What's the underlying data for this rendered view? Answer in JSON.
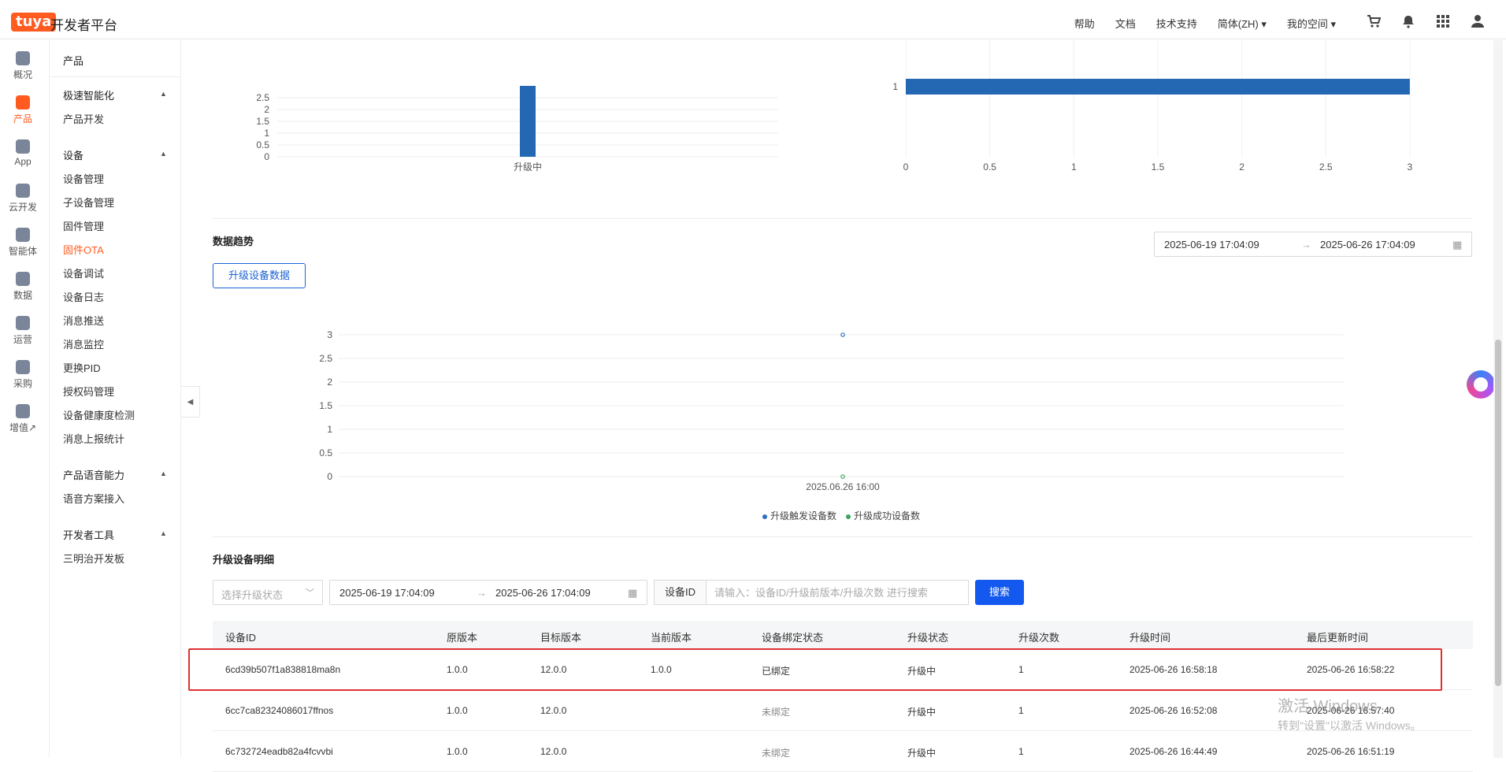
{
  "header": {
    "logo_text": "tuya",
    "brand": "开发者平台",
    "nav": [
      "帮助",
      "文档",
      "技术支持",
      "简体(ZH) ▾",
      "我的空间 ▾"
    ],
    "icons": [
      "cart-icon",
      "bell-icon",
      "apps-grid-icon",
      "user-icon"
    ]
  },
  "rail": [
    {
      "label": "概况",
      "icon": "home-icon"
    },
    {
      "label": "产品",
      "icon": "terminal-icon",
      "active": true
    },
    {
      "label": "App",
      "icon": "phone-icon"
    },
    {
      "label": "云开发",
      "icon": "cloud-icon"
    },
    {
      "label": "智能体",
      "icon": "agent-icon"
    },
    {
      "label": "数据",
      "icon": "chart-icon"
    },
    {
      "label": "运营",
      "icon": "operation-icon"
    },
    {
      "label": "采购",
      "icon": "shop-icon"
    },
    {
      "label": "增值↗",
      "icon": "value-added-icon"
    }
  ],
  "submenu": {
    "title": "产品",
    "group1": {
      "label": "极速智能化",
      "items": [
        "产品开发"
      ]
    },
    "group2": {
      "label": "设备",
      "items": [
        "设备管理",
        "子设备管理",
        "固件管理",
        "固件OTA",
        "设备调试",
        "设备日志",
        "消息推送",
        "消息监控",
        "更换PID",
        "授权码管理",
        "设备健康度检测",
        "消息上报统计"
      ]
    },
    "group3": {
      "label": "产品语音能力",
      "items": [
        "语音方案接入"
      ]
    },
    "group4": {
      "label": "开发者工具",
      "items": [
        "三明治开发板"
      ]
    }
  },
  "chart_data": [
    {
      "type": "bar",
      "categories": [
        "升级中"
      ],
      "values": [
        3
      ],
      "yticks": [
        "0",
        "0.5",
        "1",
        "1.5",
        "2",
        "2.5"
      ],
      "ylim": [
        0,
        3
      ]
    },
    {
      "type": "bar",
      "orientation": "horizontal",
      "categories": [
        "1"
      ],
      "values": [
        3
      ],
      "xticks": [
        "0",
        "0.5",
        "1",
        "1.5",
        "2",
        "2.5",
        "3"
      ],
      "xlim": [
        0,
        3
      ]
    },
    {
      "type": "scatter",
      "x": [
        "2025.06.26 16:00"
      ],
      "series": [
        {
          "name": "升级触发设备数",
          "values": [
            3
          ],
          "color": "#2f6fc0"
        },
        {
          "name": "升级成功设备数",
          "values": [
            0
          ],
          "color": "#3aa55a"
        }
      ],
      "yticks": [
        "0",
        "0.5",
        "1",
        "1.5",
        "2",
        "2.5",
        "3"
      ],
      "ylim": [
        0,
        3
      ]
    }
  ],
  "trend": {
    "title": "数据趋势",
    "date_start": "2025-06-19 17:04:09",
    "date_end": "2025-06-26 17:04:09",
    "tab_label": "升级设备数据"
  },
  "detail": {
    "title": "升级设备明细",
    "status_placeholder": "选择升级状态",
    "date_start": "2025-06-19 17:04:09",
    "date_end": "2025-06-26 17:04:09",
    "device_id_label": "设备ID",
    "search_placeholder": "请输入：设备ID/升级前版本/升级次数 进行搜索",
    "search_button": "搜索",
    "columns": [
      "设备ID",
      "原版本",
      "目标版本",
      "当前版本",
      "设备绑定状态",
      "升级状态",
      "升级次数",
      "升级时间",
      "最后更新时间"
    ],
    "rows": [
      [
        "6cd39b507f1a838818ma8n",
        "1.0.0",
        "12.0.0",
        "1.0.0",
        "已绑定",
        "升级中",
        "1",
        "2025-06-26 16:58:18",
        "2025-06-26 16:58:22"
      ],
      [
        "6cc7ca82324086017ffnos",
        "1.0.0",
        "12.0.0",
        "",
        "未绑定",
        "升级中",
        "1",
        "2025-06-26 16:52:08",
        "2025-06-26 16:57:40"
      ],
      [
        "6c732724eadb82a4fcvvbi",
        "1.0.0",
        "12.0.0",
        "",
        "未绑定",
        "升级中",
        "1",
        "2025-06-26 16:44:49",
        "2025-06-26 16:51:19"
      ]
    ]
  },
  "watermark": {
    "line1": "激活 Windows",
    "line2": "转到\"设置\"以激活 Windows。"
  }
}
